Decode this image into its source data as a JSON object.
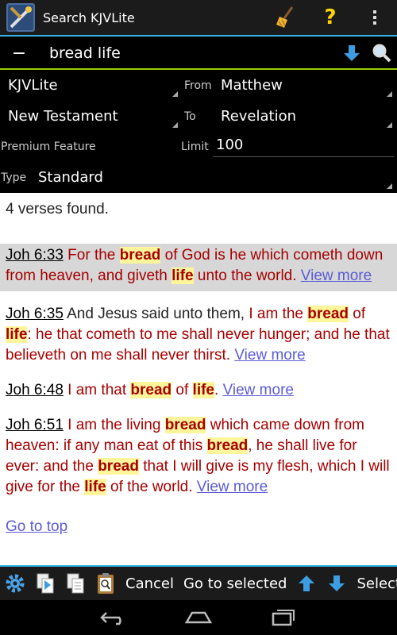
{
  "titlebar": {
    "title": "Search KJVLite"
  },
  "search": {
    "minus": "−",
    "query": "bread life"
  },
  "filters": {
    "module": "KJVLite",
    "from_label": "From",
    "from_value": "Matthew",
    "scope": "New Testament",
    "to_label": "To",
    "to_value": "Revelation",
    "premium": "Premium Feature",
    "limit_label": "Limit",
    "limit_value": "100",
    "type_label": "Type",
    "type_value": "Standard"
  },
  "results": {
    "count_text": "4 verses found.",
    "verses": [
      {
        "ref": "Joh 6:33",
        "t1": " For the ",
        "h1": "bread",
        "t2": " of God is he which cometh down from heaven, and giveth ",
        "h2": "life",
        "t3": " unto the world.",
        "more": "View more"
      },
      {
        "ref": "Joh 6:35",
        "t0": " And Jesus said unto them, ",
        "t1": "I am the ",
        "h1": "bread",
        "t2": " of ",
        "h2": "life",
        "t3": ": he that cometh to me shall never hunger; and he that believeth on me shall never thirst.",
        "more": "View more"
      },
      {
        "ref": "Joh 6:48",
        "t1": " I am that ",
        "h1": "bread",
        "t2": " of ",
        "h2": "life",
        "t3": ".",
        "more": "View more"
      },
      {
        "ref": "Joh 6:51",
        "t1": " I am the living ",
        "h1": "bread",
        "t2": " which came down from heaven: if any man eat of this ",
        "h2": "bread",
        "t3": ", he shall live for ever: and the ",
        "h3": "bread",
        "t4": " that I will give is my flesh, which I will give for the ",
        "h4": "life",
        "t5": " of the world.",
        "more": "View more"
      }
    ],
    "go_to_top": "Go to top"
  },
  "actionbar": {
    "cancel": "Cancel",
    "go_to_selected": "Go to selected",
    "select": "Select"
  },
  "colors": {
    "accent_blue": "#33b5e5",
    "accent_green": "#99cc00",
    "verse_red": "#a50000",
    "highlight": "#fff59a",
    "link": "#5b5bd6"
  }
}
